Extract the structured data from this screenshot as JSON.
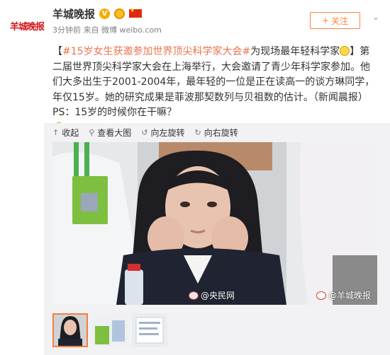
{
  "account": {
    "logo_text": "羊城晚报",
    "name": "羊城晚报",
    "meta": "3分钟前 来自 微博 weibo.com"
  },
  "follow": {
    "plus": "+",
    "label": "关注"
  },
  "post": {
    "bracket_open": "【",
    "topic": "#15岁女生获邀参加世界顶尖科学家大会#",
    "text_1": "为现场最年轻科学家",
    "text_2": "】第二届世界顶尖科学家大会在上海举行，大会邀请了青少年科学家参加。他们大多出生于2001-2004年，最年轻的一位是正在读高一的谈方琳同学，年仅15岁。她的研究成果是菲波那契数列与贝祖数的估计。（新闻晨报）PS：15岁的时候你在干嘛？"
  },
  "toolbar": {
    "collapse": "收起",
    "view_large": "查看大图",
    "rotate_left": "向左旋转",
    "rotate_right": "向右旋转"
  },
  "photo": {
    "watermark_left": "@央民网",
    "watermark_right": "@羊城晚报"
  },
  "colors": {
    "brand_red": "#d2141a",
    "accent_orange": "#ff8140",
    "topic_orange": "#eb7350",
    "meta_gray": "#808080"
  },
  "icons": [
    "v-badge-icon",
    "medal-icon",
    "china-flag-icon",
    "chevron-down-icon",
    "collapse-icon",
    "magnify-icon",
    "rotate-left-icon",
    "rotate-right-icon"
  ]
}
